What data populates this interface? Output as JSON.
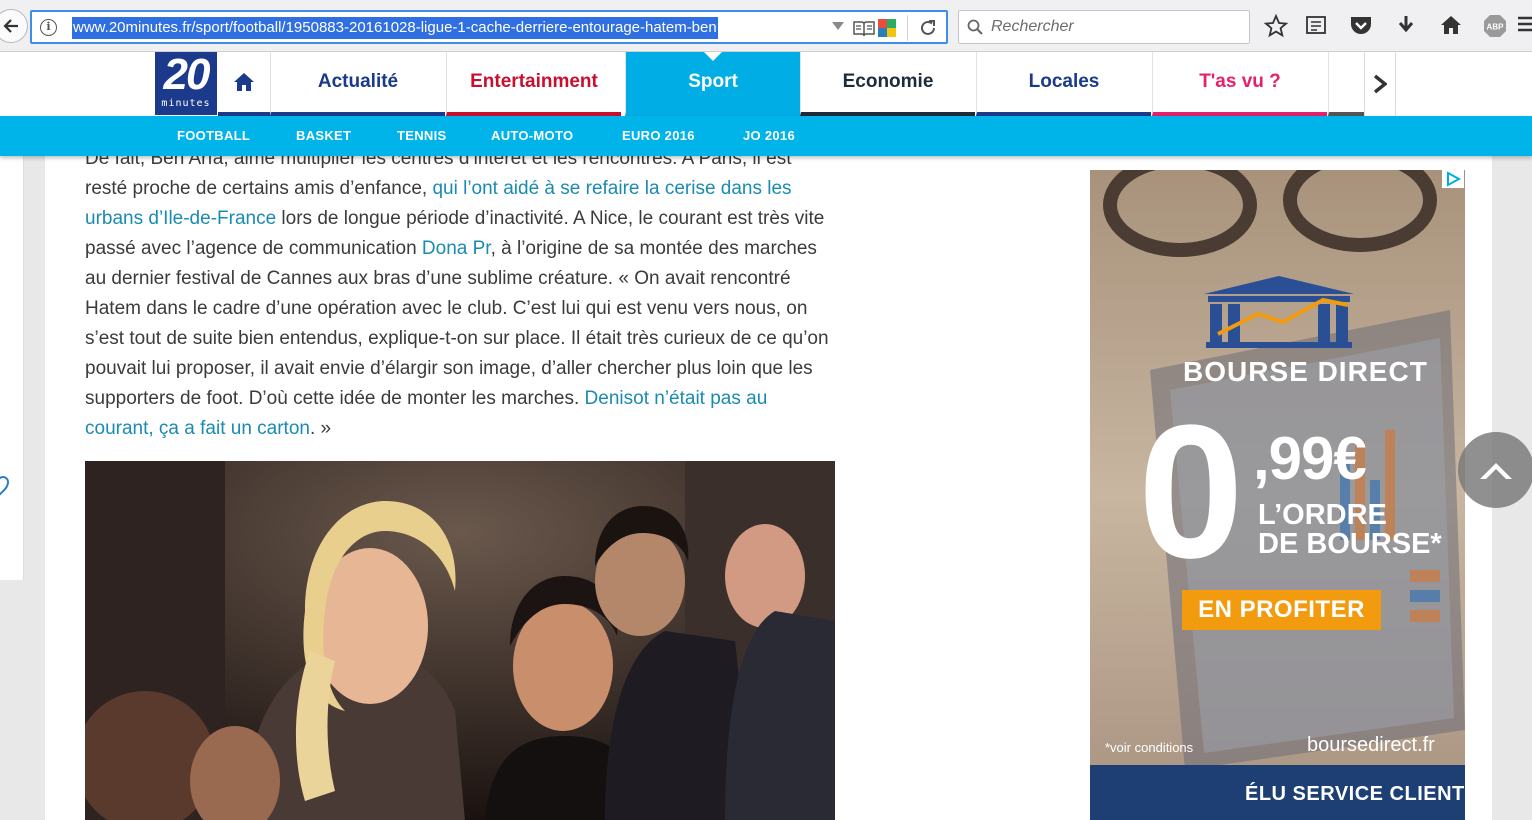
{
  "browser": {
    "url": "www.20minutes.fr/sport/football/1950883-20161028-ligue-1-cache-derriere-entourage-hatem-ben",
    "search_placeholder": "Rechercher",
    "abp_label": "ABP"
  },
  "logo": {
    "big": "20",
    "small": "minutes"
  },
  "nav": {
    "items": [
      {
        "label": "Actualité",
        "color": "#1b3a8c",
        "underline": "#1b3a8c"
      },
      {
        "label": "Entertainment",
        "color": "#c8102e",
        "underline": "#c8102e"
      },
      {
        "label": "Sport",
        "color": "#ffffff",
        "underline": "#00aee5"
      },
      {
        "label": "Economie",
        "color": "#1d2b3a",
        "underline": "#1d2b3a"
      },
      {
        "label": "Locales",
        "color": "#1b3a8c",
        "underline": "#1b3a8c"
      },
      {
        "label": "T'as vu ?",
        "color": "#e4226b",
        "underline": "#e4226b"
      }
    ],
    "sub_items": [
      "FOOTBALL",
      "BASKET",
      "TENNIS",
      "AUTO-MOTO",
      "EURO 2016",
      "JO 2016"
    ]
  },
  "article": {
    "p1_text1": "De fait, Ben Arfa, aime multiplier les centres d’intérêt et les rencontres. A Paris, il est resté proche de certains amis d’enfance, ",
    "p1_link1": "qui l’ont aidé à se refaire la cerise dans les urbans d’Ile-de-France",
    "p1_text2": " lors de longue période d’inactivité. A Nice, le courant est très vite passé avec l’agence de communication ",
    "p1_link2": "Dona Pr",
    "p1_text3": ", à l’origine de sa montée des marches au dernier festival de Cannes aux bras d’une sublime créature. « On avait rencontré Hatem dans le cadre d’une opération avec le club. C’est lui qui est venu vers nous, on s’est tout de suite bien entendus, explique-t-on sur place. Il était très curieux de ce qu’on pouvait lui proposer, il avait envie d’élargir son image, d’aller chercher plus loin que les supporters de foot. D’où cette idée de monter les marches. ",
    "p1_link3": "Denisot n’était pas au courant, ça a fait un carton",
    "p1_text4": ". »"
  },
  "ad": {
    "brand": "BOURSE DIRECT",
    "zero": "0",
    "price": ",99€",
    "order_line1": "L’ORDRE",
    "order_line2": "DE BOURSE",
    "order_mark": "*",
    "cta": "EN PROFITER",
    "conditions": "*voir conditions",
    "domain": "boursedirect.fr",
    "band_text": "ÉLU SERVICE CLIENT"
  }
}
